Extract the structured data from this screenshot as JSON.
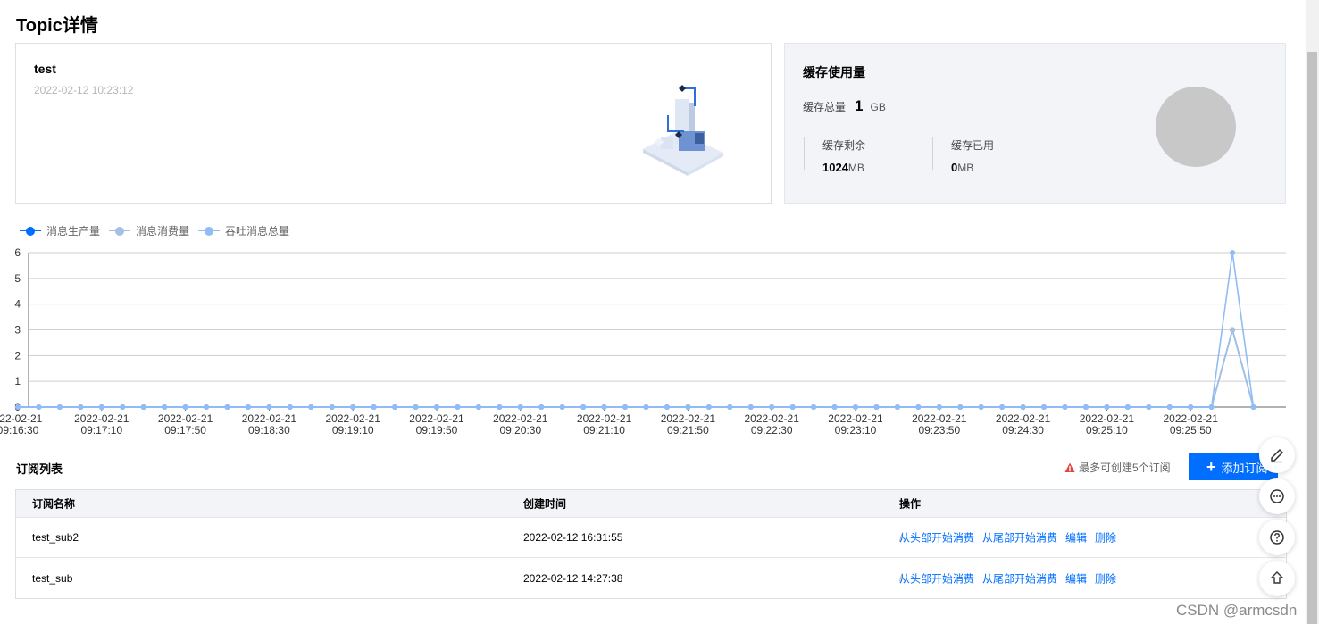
{
  "page": {
    "title": "Topic详情"
  },
  "topic": {
    "name": "test",
    "created": "2022-02-12 10:23:12"
  },
  "cache": {
    "title": "缓存使用量",
    "total_label": "缓存总量",
    "total_value": "1",
    "total_unit": "GB",
    "remaining_label": "缓存剩余",
    "remaining_value": "1024",
    "remaining_unit": "MB",
    "used_label": "缓存已用",
    "used_value": "0",
    "used_unit": "MB",
    "usage_fraction": 0
  },
  "legend": [
    {
      "label": "消息生产量",
      "color": "#006eff"
    },
    {
      "label": "消息消费量",
      "color": "#a6bfe4"
    },
    {
      "label": "吞吐消息总量",
      "color": "#8fbdf4"
    }
  ],
  "chart_data": {
    "type": "line",
    "ylim": [
      0,
      6
    ],
    "yticks": [
      0,
      1,
      2,
      3,
      4,
      5,
      6
    ],
    "x_tick_labels": [
      [
        "022-02-21",
        "09:16:30"
      ],
      [
        "2022-02-21",
        "09:17:10"
      ],
      [
        "2022-02-21",
        "09:17:50"
      ],
      [
        "2022-02-21",
        "09:18:30"
      ],
      [
        "2022-02-21",
        "09:19:10"
      ],
      [
        "2022-02-21",
        "09:19:50"
      ],
      [
        "2022-02-21",
        "09:20:30"
      ],
      [
        "2022-02-21",
        "09:21:10"
      ],
      [
        "2022-02-21",
        "09:21:50"
      ],
      [
        "2022-02-21",
        "09:22:30"
      ],
      [
        "2022-02-21",
        "09:23:10"
      ],
      [
        "2022-02-21",
        "09:23:50"
      ],
      [
        "2022-02-21",
        "09:24:30"
      ],
      [
        "2022-02-21",
        "09:25:10"
      ],
      [
        "2022-02-21",
        "09:25:50"
      ]
    ],
    "point_count": 60,
    "series": [
      {
        "name": "消息生产量",
        "nonzero": {
          "58": 3
        }
      },
      {
        "name": "消息消费量",
        "nonzero": {
          "58": 3
        }
      },
      {
        "name": "吞吐消息总量",
        "nonzero": {
          "58": 6
        }
      }
    ]
  },
  "subscriptions": {
    "title": "订阅列表",
    "limit_tip": "最多可创建5个订阅",
    "add_button": "添加订阅",
    "columns": [
      "订阅名称",
      "创建时间",
      "操作"
    ],
    "rows": [
      {
        "name": "test_sub2",
        "created": "2022-02-12 16:31:55"
      },
      {
        "name": "test_sub",
        "created": "2022-02-12 14:27:38"
      }
    ],
    "actions": [
      "从头部开始消费",
      "从尾部开始消费",
      "编辑",
      "删除"
    ],
    "action_sep": "/"
  },
  "watermark": "CSDN @armcsdn"
}
